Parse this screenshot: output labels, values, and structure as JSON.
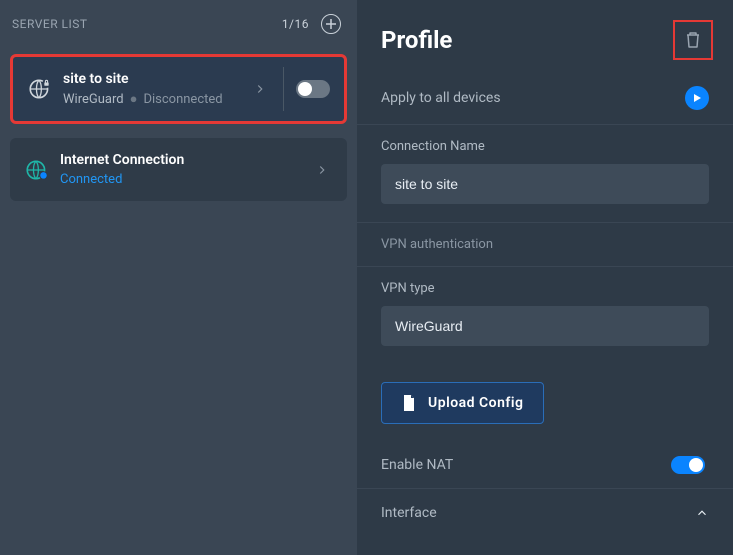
{
  "sidebar": {
    "title": "SERVER LIST",
    "count": "1/16",
    "items": [
      {
        "name": "site to site",
        "protocol": "WireGuard",
        "status": "Disconnected",
        "connected": false,
        "selected": true,
        "hasToggle": true,
        "toggleOn": false
      },
      {
        "name": "Internet Connection",
        "protocol": "",
        "status": "Connected",
        "connected": true,
        "selected": false,
        "hasToggle": false
      }
    ]
  },
  "profile": {
    "title": "Profile",
    "applyLabel": "Apply to all devices",
    "connectionNameLabel": "Connection Name",
    "connectionNameValue": "site to site",
    "vpnAuthLabel": "VPN authentication",
    "vpnTypeLabel": "VPN type",
    "vpnTypeValue": "WireGuard",
    "uploadLabel": "Upload Config",
    "enableNatLabel": "Enable NAT",
    "enableNatOn": true,
    "interfaceLabel": "Interface"
  }
}
